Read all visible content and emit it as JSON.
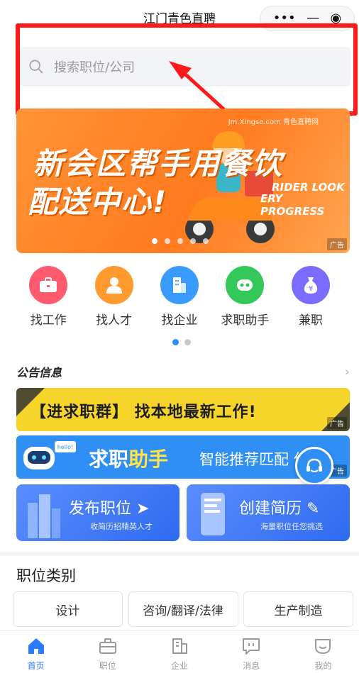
{
  "header": {
    "title": "江门青色直聘",
    "capsule_icons": [
      "more-dots-icon",
      "minimize-icon",
      "target-icon"
    ]
  },
  "search": {
    "placeholder": "搜索职位/公司",
    "icon": "search-icon"
  },
  "annotation": {
    "color": "#ff1a1a"
  },
  "banner": {
    "site_text": "Jm.Xingse.com  青色直聘网",
    "headline_line1": "新会区帮手用餐饮",
    "headline_line2": "配送中心!",
    "english_line1": "RIDER LOOK",
    "english_line2": "ERY PROGRESS",
    "ad_badge": "广告",
    "slide_count": 5,
    "active_slide": 0
  },
  "grid": {
    "items": [
      {
        "label": "找工作",
        "icon": "briefcase-icon",
        "color": "#ff5a6e"
      },
      {
        "label": "找人才",
        "icon": "person-icon",
        "color": "#ff9a2e"
      },
      {
        "label": "找企业",
        "icon": "building-icon",
        "color": "#3a9bff"
      },
      {
        "label": "求职助手",
        "icon": "robot-icon",
        "color": "#34c759"
      },
      {
        "label": "兼职",
        "icon": "money-bag-icon",
        "color": "#7b6cff"
      }
    ],
    "page_count": 2,
    "active_page": 0
  },
  "notice": {
    "title": "公告信息",
    "more_icon": "chevron-right-icon"
  },
  "ads": {
    "strip1_text": "【进求职群】 找本地最新工作!",
    "strip1_badge": "广告",
    "strip2_text_a": "求职",
    "strip2_text_b": "助手",
    "strip2_robot_label": "hello!",
    "strip2_sub": "智能推荐匹配 位",
    "strip2_badge": "广告",
    "float_icon": "customer-service-icon"
  },
  "cards": [
    {
      "title": "发布职位",
      "subtitle": "收简历招精英人才",
      "icon": "send-icon"
    },
    {
      "title": "创建简历",
      "subtitle": "海量职位任您挑选",
      "icon": "edit-icon"
    }
  ],
  "category": {
    "title": "职位类别",
    "chips": [
      "设计",
      "咨询/翻译/法律",
      "生产制造"
    ]
  },
  "tabbar": {
    "active_color": "#2b7bff",
    "inactive_color": "#9a9a9a",
    "tabs": [
      {
        "label": "首页",
        "icon": "home-icon",
        "active": true
      },
      {
        "label": "职位",
        "icon": "briefcase-icon",
        "active": false
      },
      {
        "label": "企业",
        "icon": "building-icon",
        "active": false
      },
      {
        "label": "消息",
        "icon": "message-icon",
        "active": false
      },
      {
        "label": "我的",
        "icon": "profile-icon",
        "active": false
      }
    ]
  }
}
